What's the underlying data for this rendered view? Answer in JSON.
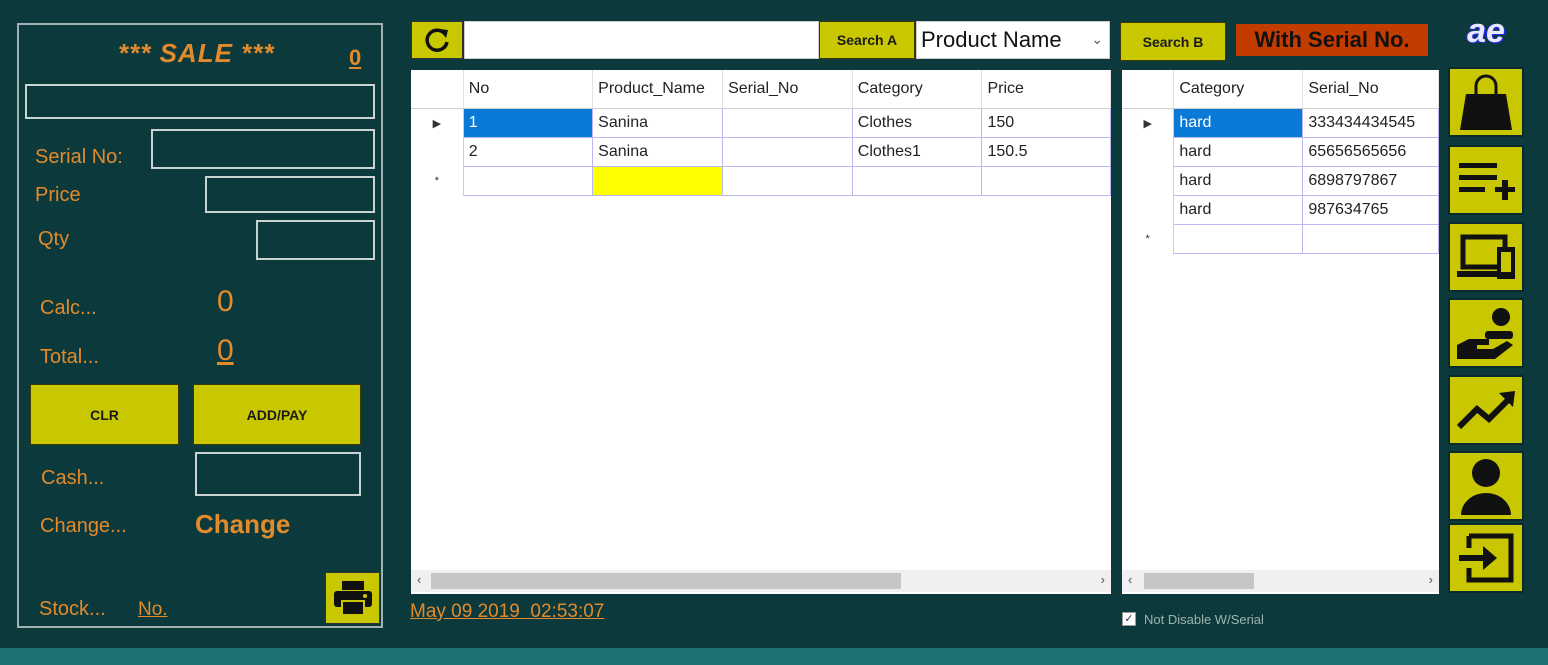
{
  "sale": {
    "title": "*** SALE ***",
    "count": "0",
    "serial_label": "Serial No:",
    "price_label": "Price",
    "qty_label": "Qty",
    "calc_label": "Calc...",
    "calc_value": "0",
    "total_label": "Total...",
    "total_value": "0",
    "clr_label": "CLR",
    "addpay_label": "ADD/PAY",
    "cash_label": "Cash...",
    "change_label": "Change...",
    "change_value": "Change",
    "stock_label": "Stock...",
    "stock_value": "No."
  },
  "toolbar": {
    "search_a_label": "Search A",
    "search_a_value": "",
    "dropdown_selected": "Product Name",
    "search_b_label": "Search B",
    "serial_badge": "With Serial No.",
    "logo_text": "ae"
  },
  "grid_a": {
    "columns": [
      "No",
      "Product_Name",
      "Serial_No",
      "Category",
      "Price"
    ],
    "rows": [
      [
        "1",
        "Sanina",
        "",
        "Clothes",
        "150"
      ],
      [
        "2",
        "Sanina",
        "",
        "Clothes1",
        "150.5"
      ]
    ]
  },
  "grid_b": {
    "columns": [
      "Category",
      "Serial_No"
    ],
    "rows": [
      [
        "hard",
        "333434434545"
      ],
      [
        "hard",
        "65656565656"
      ],
      [
        "hard",
        "6898797867"
      ],
      [
        "hard",
        "987634765"
      ]
    ]
  },
  "status": {
    "datetime": "May 09 2019  02:53:07",
    "checkbox_label": "Not Disable W/Serial",
    "checkbox_checked": true
  },
  "sidebar_icons": [
    "shopping-bag-icon",
    "add-list-icon",
    "devices-icon",
    "payment-hand-icon",
    "trend-chart-icon",
    "user-icon",
    "exit-icon"
  ],
  "colors": {
    "background": "#0c3a3c",
    "accent_yellow": "#c9c700",
    "orange_text": "#e38a2b",
    "badge_red": "#c23c00",
    "selection_blue": "#0b7ad6"
  }
}
